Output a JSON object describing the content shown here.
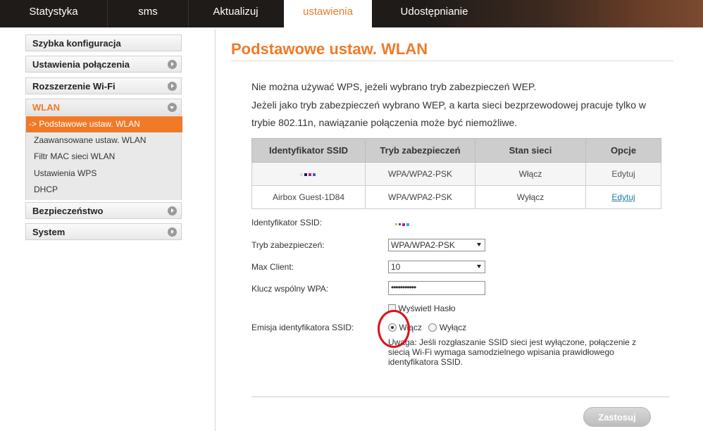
{
  "nav": {
    "tabs": [
      {
        "label": "Statystyka"
      },
      {
        "label": "sms"
      },
      {
        "label": "Aktualizuj"
      },
      {
        "label": "ustawienia"
      },
      {
        "label": "Udostępnianie"
      }
    ],
    "active_index": 3
  },
  "sidebar": {
    "items": [
      {
        "label": "Szybka konfiguracja"
      },
      {
        "label": "Ustawienia połączenia"
      },
      {
        "label": "Rozszerzenie Wi-Fi"
      },
      {
        "label": "WLAN"
      },
      {
        "label": "Bezpieczeństwo"
      },
      {
        "label": "System"
      }
    ],
    "wlan_sub": [
      {
        "label": "-> Podstawowe ustaw. WLAN"
      },
      {
        "label": "Zaawansowane ustaw. WLAN"
      },
      {
        "label": "Filtr MAC sieci WLAN"
      },
      {
        "label": "Ustawienia WPS"
      },
      {
        "label": "DHCP"
      }
    ]
  },
  "main": {
    "title": "Podstawowe ustaw. WLAN",
    "notice_lines": [
      "Nie można używać WPS, jeżeli wybrano tryb zabezpieczeń WEP.",
      "Jeżeli jako tryb zabezpieczeń wybrano WEP, a karta sieci bezprzewodowej pracuje tylko w",
      "trybie 802.11n, nawiązanie połączenia może być niemożliwe."
    ],
    "table": {
      "headers": [
        "Identyfikator SSID",
        "Tryb zabezpieczeń",
        "Stan sieci",
        "Opcje"
      ],
      "rows": [
        {
          "ssid": "",
          "mode": "WPA/WPA2-PSK",
          "state": "Włącz",
          "option": "Edytuj"
        },
        {
          "ssid": "Airbox Guest-1D84",
          "mode": "WPA/WPA2-PSK",
          "state": "Wyłącz",
          "option": "Edytuj"
        }
      ]
    },
    "form": {
      "ssid_label": "Identyfikator SSID:",
      "security_label": "Tryb zabezpieczeń:",
      "security_value": "WPA/WPA2-PSK",
      "maxclient_label": "Max Client:",
      "maxclient_value": "10",
      "wpa_key_label": "Klucz wspólny WPA:",
      "wpa_key_value": "•••••••••••",
      "show_password_label": "Wyświetl Hasło",
      "broadcast_label": "Emisja identyfikatora SSID:",
      "radio_on_label": "Włącz",
      "radio_off_label": "Wyłącz",
      "radio_selected": "on",
      "note": "Uwaga: Jeśli rozgłaszanie SSID sieci jest wyłączone, połączenie z siecią Wi-Fi wymaga samodzielnego wpisania prawidłowego identyfikatora SSID."
    },
    "apply_label": "Zastosuj"
  },
  "colors": {
    "accent": "#f07a28",
    "highlight_circle": "#e0101a",
    "link": "#1a7fa8"
  }
}
